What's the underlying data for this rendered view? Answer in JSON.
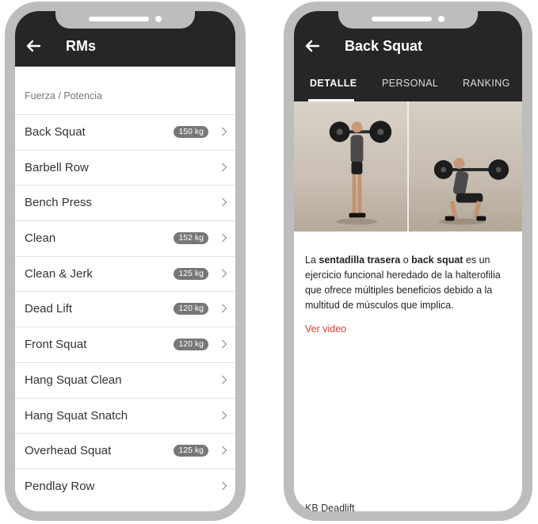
{
  "left_screen": {
    "title": "RMs",
    "section_label": "Fuerza / Potencia",
    "items": [
      {
        "label": "Back Squat",
        "badge": "150 kg"
      },
      {
        "label": "Barbell Row",
        "badge": ""
      },
      {
        "label": "Bench Press",
        "badge": ""
      },
      {
        "label": "Clean",
        "badge": "152 kg"
      },
      {
        "label": "Clean & Jerk",
        "badge": "125 kg"
      },
      {
        "label": "Dead Lift",
        "badge": "120 kg"
      },
      {
        "label": "Front Squat",
        "badge": "120 kg"
      },
      {
        "label": "Hang Squat Clean",
        "badge": ""
      },
      {
        "label": "Hang Squat Snatch",
        "badge": ""
      },
      {
        "label": "Overhead Squat",
        "badge": "125 kg"
      },
      {
        "label": "Pendlay Row",
        "badge": ""
      }
    ]
  },
  "right_screen": {
    "title": "Back Squat",
    "tabs": [
      "DETALLE",
      "PERSONAL",
      "RANKING"
    ],
    "active_tab": "DETALLE",
    "description": {
      "p1": "La ",
      "b1": "sentadilla trasera",
      "p2": " o ",
      "b2": "back squat",
      "p3": " es un ejercicio funcional heredado de la halterofilia que ofrece múltiples beneficios debido a la multitud de músculos que implica."
    },
    "video_link": "Ver video",
    "next_item": "KB Deadlift"
  },
  "colors": {
    "appbar": "#262626",
    "badge": "#777777",
    "link": "#e53935",
    "phone_frame": "#bdbdbd"
  },
  "icons": {
    "back": "arrow-left-icon",
    "chevron": "chevron-right-icon"
  }
}
